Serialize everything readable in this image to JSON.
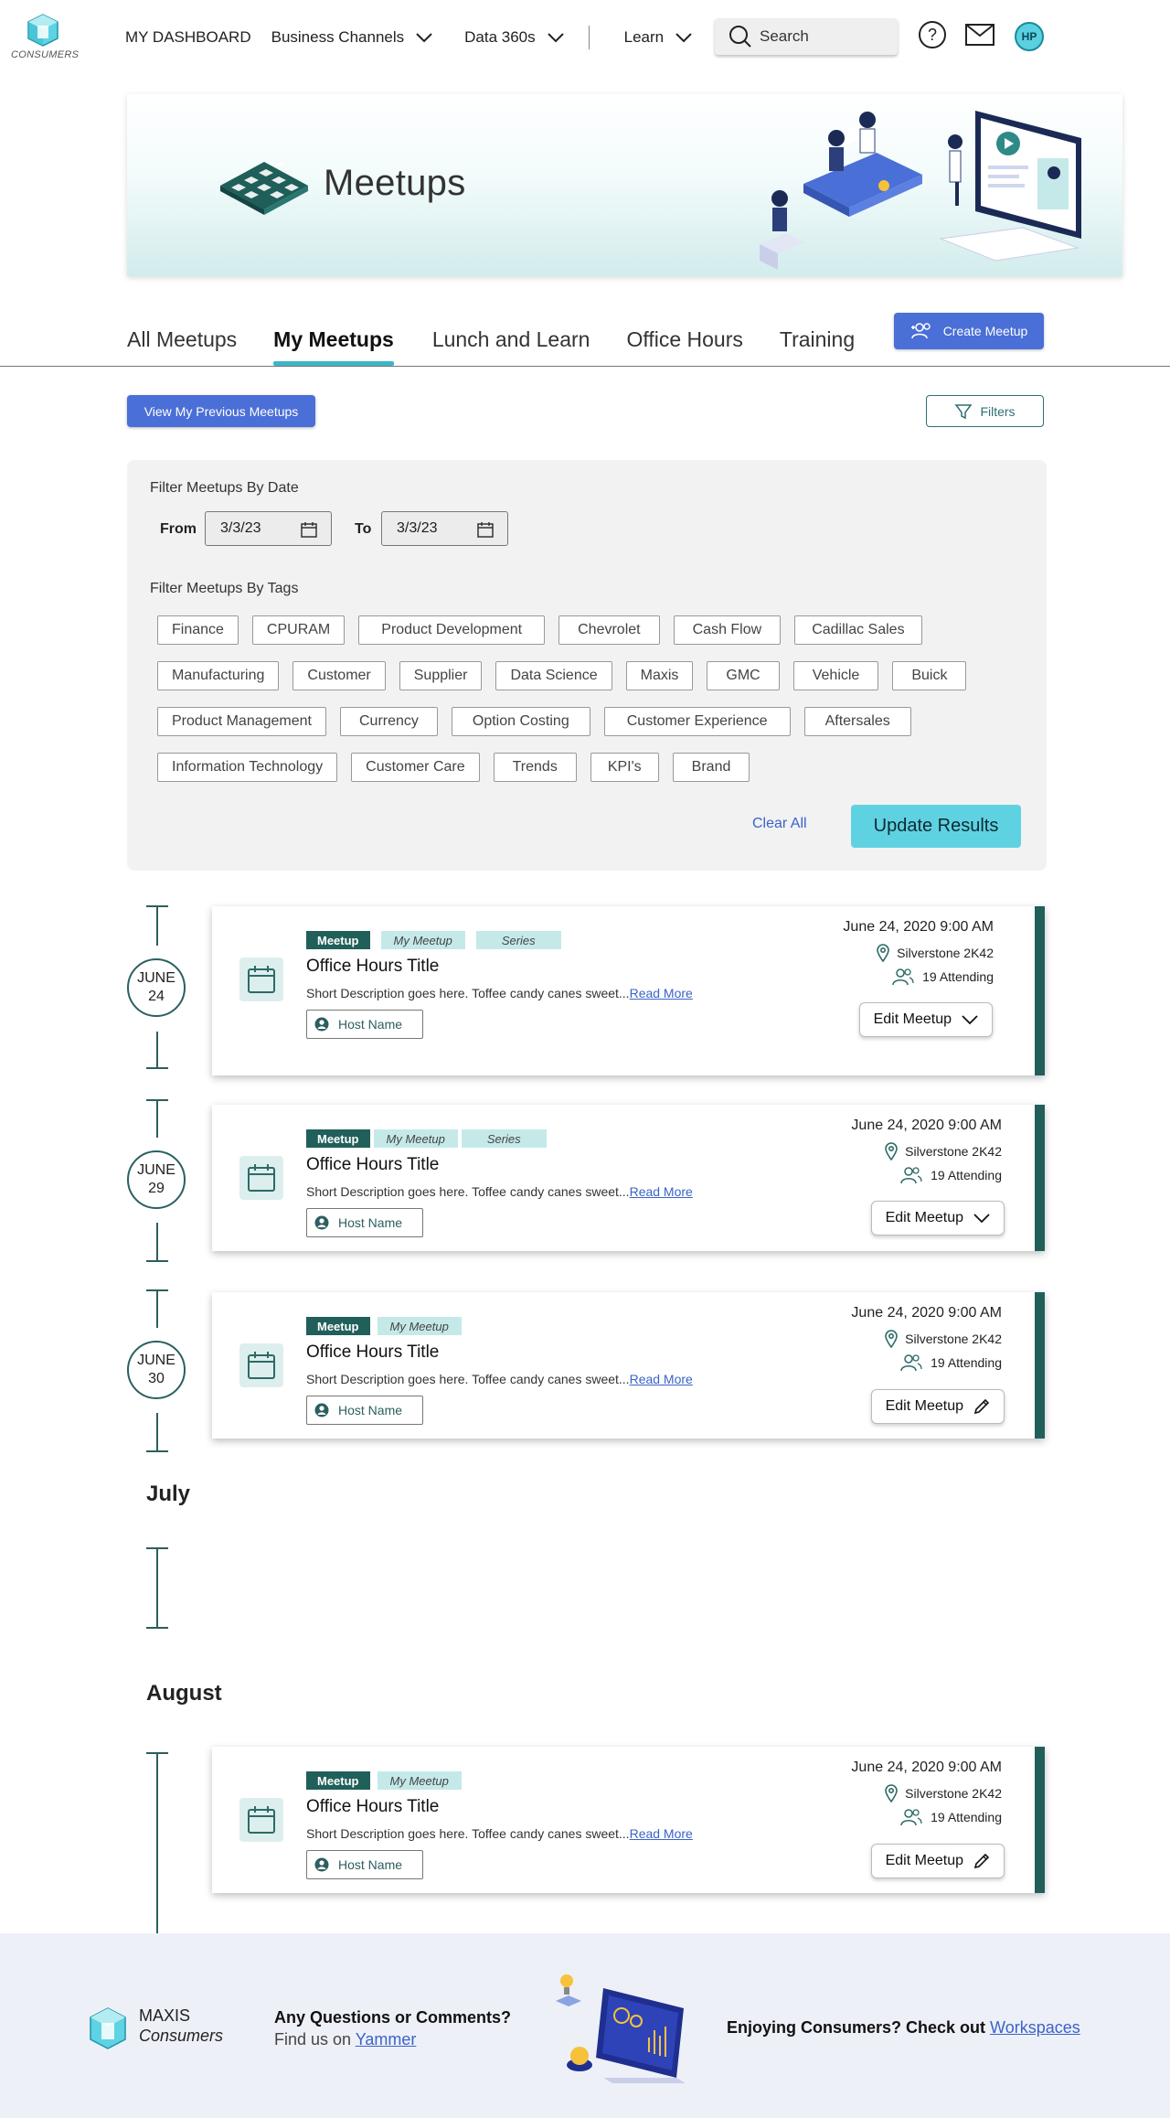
{
  "header": {
    "logo_text": "CONSUMERS",
    "nav": [
      {
        "label": "MY DASHBOARD"
      },
      {
        "label": "Business Channels"
      },
      {
        "label": "Data 360s"
      },
      {
        "label": "Learn"
      }
    ],
    "search_placeholder": "Search",
    "avatar_initials": "HP"
  },
  "hero": {
    "title": "Meetups"
  },
  "tabs": [
    {
      "label": "All Meetups"
    },
    {
      "label": "My Meetups",
      "active": true
    },
    {
      "label": "Lunch and Learn"
    },
    {
      "label": "Office Hours"
    },
    {
      "label": "Training"
    }
  ],
  "create_button": "Create Meetup",
  "prev_button": "View My Previous Meetups",
  "filters_button": "Filters",
  "filter_panel": {
    "date_label": "Filter Meetups By Date",
    "from_label": "From",
    "from_value": "3/3/23",
    "to_label": "To",
    "to_value": "3/3/23",
    "tags_label": "Filter Meetups By Tags",
    "tag_rows": [
      [
        "Finance",
        "CPURAM",
        "Product Development",
        "Chevrolet",
        "Cash Flow",
        "Cadillac Sales"
      ],
      [
        "Manufacturing",
        "Customer",
        "Supplier",
        "Data Science",
        "Maxis",
        "GMC",
        "Vehicle",
        "Buick"
      ],
      [
        "Product Management",
        "Currency",
        "Option Costing",
        "Customer Experience",
        "Aftersales"
      ],
      [
        "Information Technology",
        "Customer Care",
        "Trends",
        "KPI's",
        "Brand"
      ]
    ],
    "clear_all": "Clear All",
    "update_button": "Update Results"
  },
  "date_circles": [
    {
      "month": "JUNE",
      "day": "24"
    },
    {
      "month": "JUNE",
      "day": "29"
    },
    {
      "month": "JUNE",
      "day": "30"
    }
  ],
  "months": [
    "July",
    "August"
  ],
  "cards": [
    {
      "pills": [
        "Meetup",
        "My Meetup",
        "Series"
      ],
      "title": "Office Hours Title",
      "description": "Short Description goes here. Toffee candy canes sweet...",
      "read_more": "Read More",
      "host": "Host Name",
      "datetime": "June 24, 2020 9:00 AM",
      "location": "Silverstone 2K42",
      "attending": "19 Attending",
      "edit_label": "Edit Meetup",
      "edit_icon": "chevron-down-icon"
    },
    {
      "pills": [
        "Meetup",
        "My Meetup",
        "Series"
      ],
      "title": "Office Hours Title",
      "description": "Short Description goes here. Toffee candy canes sweet...",
      "read_more": "Read More",
      "host": "Host Name",
      "datetime": "June 24, 2020 9:00 AM",
      "location": "Silverstone 2K42",
      "attending": "19 Attending",
      "edit_label": "Edit Meetup",
      "edit_icon": "chevron-down-icon"
    },
    {
      "pills": [
        "Meetup",
        "My Meetup"
      ],
      "title": "Office Hours Title",
      "description": "Short Description goes here. Toffee candy canes sweet...",
      "read_more": "Read More",
      "host": "Host Name",
      "datetime": "June 24, 2020 9:00 AM",
      "location": "Silverstone 2K42",
      "attending": "19 Attending",
      "edit_label": "Edit Meetup",
      "edit_icon": "pencil-icon"
    },
    {
      "pills": [
        "Meetup",
        "My Meetup"
      ],
      "title": "Office Hours Title",
      "description": "Short Description goes here. Toffee candy canes sweet...",
      "read_more": "Read More",
      "host": "Host Name",
      "datetime": "June 24, 2020 9:00 AM",
      "location": "Silverstone 2K42",
      "attending": "19 Attending",
      "edit_label": "Edit Meetup",
      "edit_icon": "pencil-icon"
    }
  ],
  "footer": {
    "brand": "MAXIS",
    "brand_sub": "Consumers",
    "question": "Any Questions or Comments?",
    "find_prefix": "Find us on ",
    "find_link": "Yammer",
    "enjoy_prefix": "Enjoying Consumers? Check out ",
    "enjoy_link": "Workspaces"
  },
  "colors": {
    "primary_blue": "#4a6fd6",
    "teal_dark": "#215f5a",
    "teal_light": "#c5e9e9",
    "cyan_button": "#5fd2e2",
    "link_blue": "#3a63c9"
  }
}
